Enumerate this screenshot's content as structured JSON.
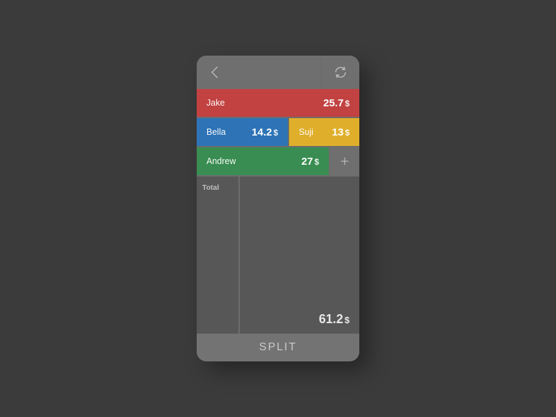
{
  "people": [
    {
      "name": "Jake",
      "amount": "25.7",
      "currency": "$"
    },
    {
      "name": "Bella",
      "amount": "14.2",
      "currency": "$"
    },
    {
      "name": "Suji",
      "amount": "13",
      "currency": "$"
    },
    {
      "name": "Andrew",
      "amount": "27",
      "currency": "$"
    }
  ],
  "total_label": "Total",
  "grand_total": {
    "amount": "61.2",
    "currency": "$"
  },
  "split_button": "SPLIT"
}
